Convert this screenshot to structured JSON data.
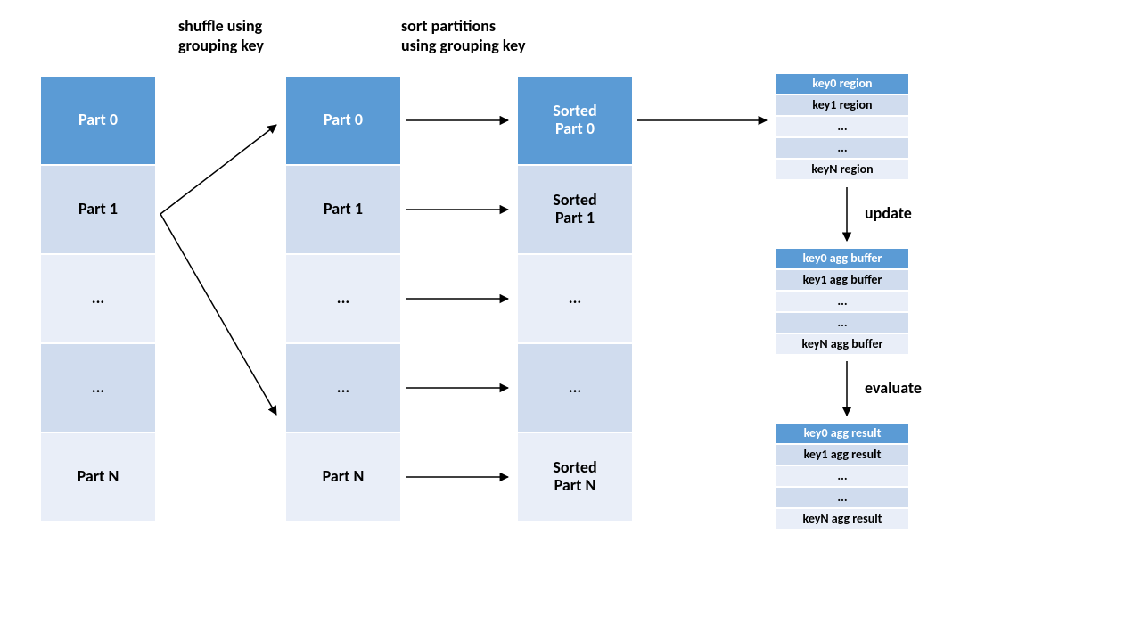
{
  "labels": {
    "shuffle": "shuffle using\ngrouping key",
    "sort": "sort partitions\nusing grouping key",
    "update": "update",
    "evaluate": "evaluate"
  },
  "columns": {
    "input": {
      "items": [
        "Part 0",
        "Part 1",
        "...",
        "...",
        "Part N"
      ]
    },
    "shuffled": {
      "items": [
        "Part 0",
        "Part 1",
        "...",
        "...",
        "Part N"
      ]
    },
    "sorted": {
      "items": [
        "Sorted\nPart 0",
        "Sorted\nPart 1",
        "...",
        "...",
        "Sorted\nPart N"
      ]
    }
  },
  "tables": {
    "regions": [
      "key0 region",
      "key1 region",
      "...",
      "...",
      "keyN region"
    ],
    "buffers": [
      "key0 agg buffer",
      "key1 agg buffer",
      "...",
      "...",
      "keyN agg buffer"
    ],
    "results": [
      "key0 agg result",
      "key1 agg result",
      "...",
      "...",
      "keyN agg result"
    ]
  }
}
